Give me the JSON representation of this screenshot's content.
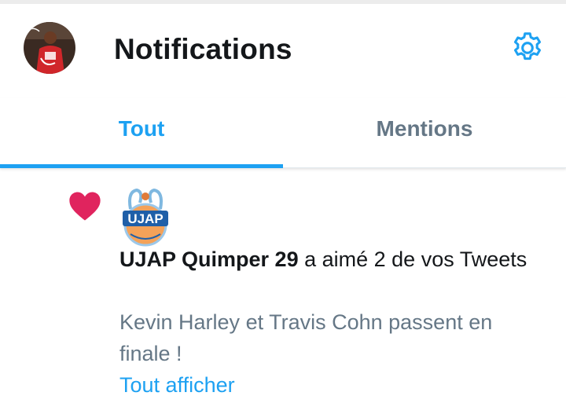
{
  "header": {
    "title": "Notifications",
    "avatar_icon": "profile-avatar",
    "settings_icon": "gear-icon"
  },
  "tabs": [
    {
      "label": "Tout",
      "active": true
    },
    {
      "label": "Mentions",
      "active": false
    }
  ],
  "notification": {
    "type_icon": "heart-icon",
    "org_logo_text": "UJAP",
    "actor": "UJAP Quimper 29",
    "action": "a aimé 2 de vos Tweets",
    "preview": "Kevin Harley et Travis Cohn passent en finale !",
    "show_all": "Tout afficher"
  },
  "colors": {
    "accent": "#1da1f2",
    "like": "#e0245e",
    "text_primary": "#14171a",
    "text_secondary": "#657786"
  }
}
